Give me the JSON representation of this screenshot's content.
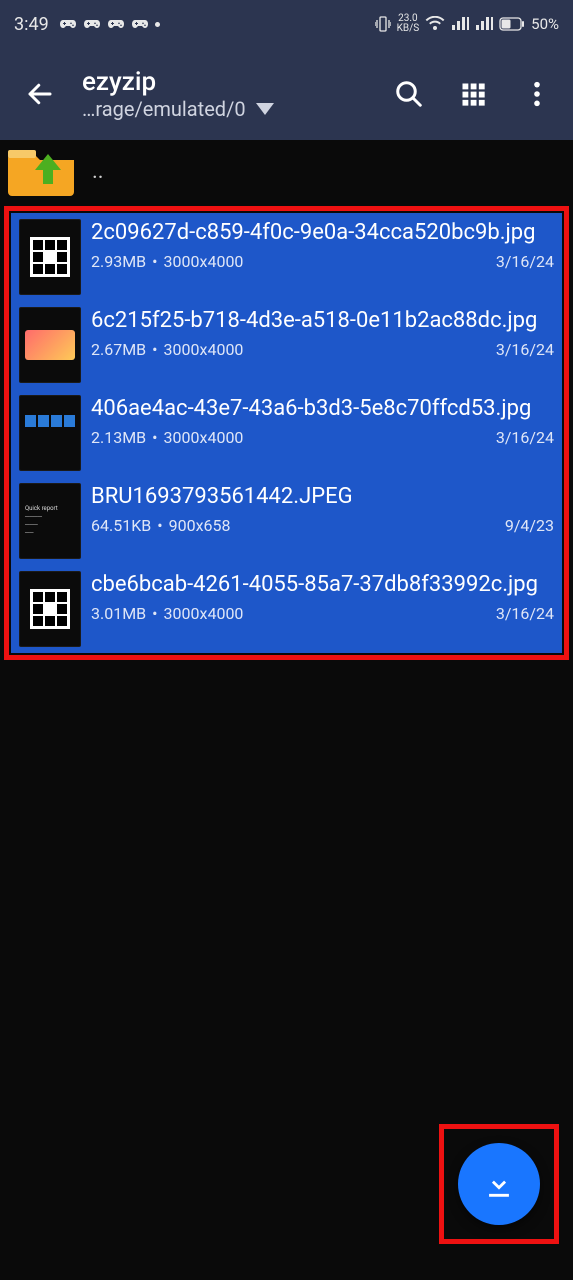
{
  "status": {
    "time": "3:49",
    "net_speed_top": "23.0",
    "net_speed_bottom": "KB/S",
    "battery": "50%"
  },
  "app": {
    "title": "ezyzip",
    "path": "…rage/emulated/0"
  },
  "up_label": "..",
  "files": [
    {
      "name": "2c09627d-c859-4f0c-9e0a-34cca520bc9b.jpg",
      "size": "2.93MB",
      "dims": "3000x4000",
      "date": "3/16/24",
      "thumb": "qr"
    },
    {
      "name": "6c215f25-b718-4d3e-a518-0e11b2ac88dc.jpg",
      "size": "2.67MB",
      "dims": "3000x4000",
      "date": "3/16/24",
      "thumb": "card"
    },
    {
      "name": "406ae4ac-43e7-43a6-b3d3-5e8c70ffcd53.jpg",
      "size": "2.13MB",
      "dims": "3000x4000",
      "date": "3/16/24",
      "thumb": "grid"
    },
    {
      "name": "BRU1693793561442.JPEG",
      "size": "64.51KB",
      "dims": "900x658",
      "date": "9/4/23",
      "thumb": "text"
    },
    {
      "name": "cbe6bcab-4261-4055-85a7-37db8f33992c.jpg",
      "size": "3.01MB",
      "dims": "3000x4000",
      "date": "3/16/24",
      "thumb": "qr"
    }
  ]
}
